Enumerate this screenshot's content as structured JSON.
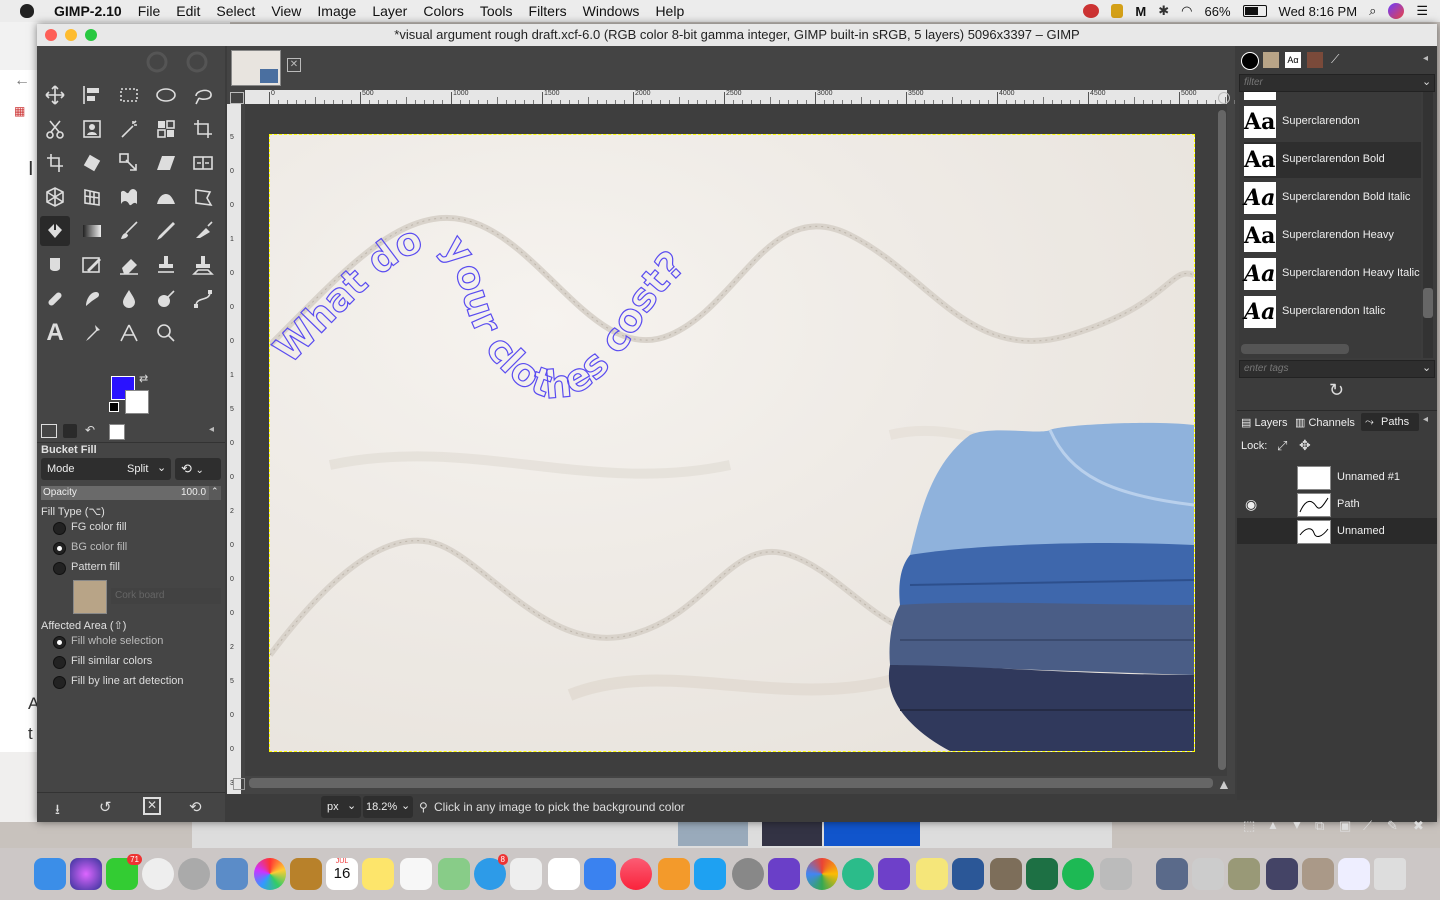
{
  "menubar": {
    "app_name": "GIMP-2.10",
    "items": [
      "File",
      "Edit",
      "Select",
      "View",
      "Image",
      "Layer",
      "Colors",
      "Tools",
      "Filters",
      "Windows",
      "Help"
    ],
    "battery": "66%",
    "clock": "Wed 8:16 PM"
  },
  "window": {
    "title": "*visual argument rough draft.xcf-6.0 (RGB color 8-bit gamma integer, GIMP built-in sRGB, 5 layers) 5096x3397 – GIMP"
  },
  "tool_options": {
    "tool_name": "Bucket Fill",
    "mode_label": "Mode",
    "mode_value": "Split",
    "opacity_label": "Opacity",
    "opacity_value": "100.0",
    "fill_type_label": "Fill Type  (⌥)",
    "fill_types": [
      "FG color fill",
      "BG color fill",
      "Pattern fill"
    ],
    "selected_fill_type": 1,
    "pattern_name": "Cork board",
    "affected_area_label": "Affected Area  (⇧)",
    "affected_areas": [
      "Fill whole selection",
      "Fill similar colors",
      "Fill by line art detection"
    ],
    "selected_affected_area": 0
  },
  "colors": {
    "fg": "#2a12ff",
    "bg": "#ffffff",
    "text_on_canvas": "#5a4cf0",
    "accent_dark": "#2a2a2a"
  },
  "ruler": {
    "h_ticks": [
      "0",
      "500",
      "1000",
      "1500",
      "2000",
      "2500",
      "3000",
      "3500",
      "4000",
      "4500",
      "5000"
    ],
    "v_ticks": [
      "5",
      "0",
      "0",
      "1",
      "0",
      "0",
      "0",
      "1",
      "5",
      "0",
      "0",
      "2",
      "0",
      "0",
      "0",
      "2",
      "5",
      "0",
      "0",
      "3"
    ]
  },
  "canvas": {
    "curved_text": "What do your clothes cost?"
  },
  "status": {
    "unit": "px",
    "zoom": "18.2%",
    "message": "Click in any image to pick the background color"
  },
  "fonts": {
    "filter_placeholder": "filter",
    "tags_placeholder": "enter tags",
    "preview_glyph": "Aa",
    "items": [
      "Superclarendon",
      "Superclarendon Bold",
      "Superclarendon Bold Italic",
      "Superclarendon Heavy",
      "Superclarendon Heavy Italic",
      "Superclarendon Italic"
    ],
    "selected_index": 1
  },
  "layers_panel": {
    "tabs": [
      "Layers",
      "Channels",
      "Paths"
    ],
    "active_tab": 2,
    "lock_label": "Lock:",
    "items": [
      "Unnamed #1",
      "Path",
      "Unnamed"
    ],
    "visible_index": 1,
    "selected_index": 2
  },
  "dock_badges": {
    "facetime": "71",
    "messages": "8",
    "calendar_month": "JUL",
    "calendar_day": "16"
  },
  "background_window": {
    "fragments": [
      "I",
      "A",
      "t"
    ]
  }
}
